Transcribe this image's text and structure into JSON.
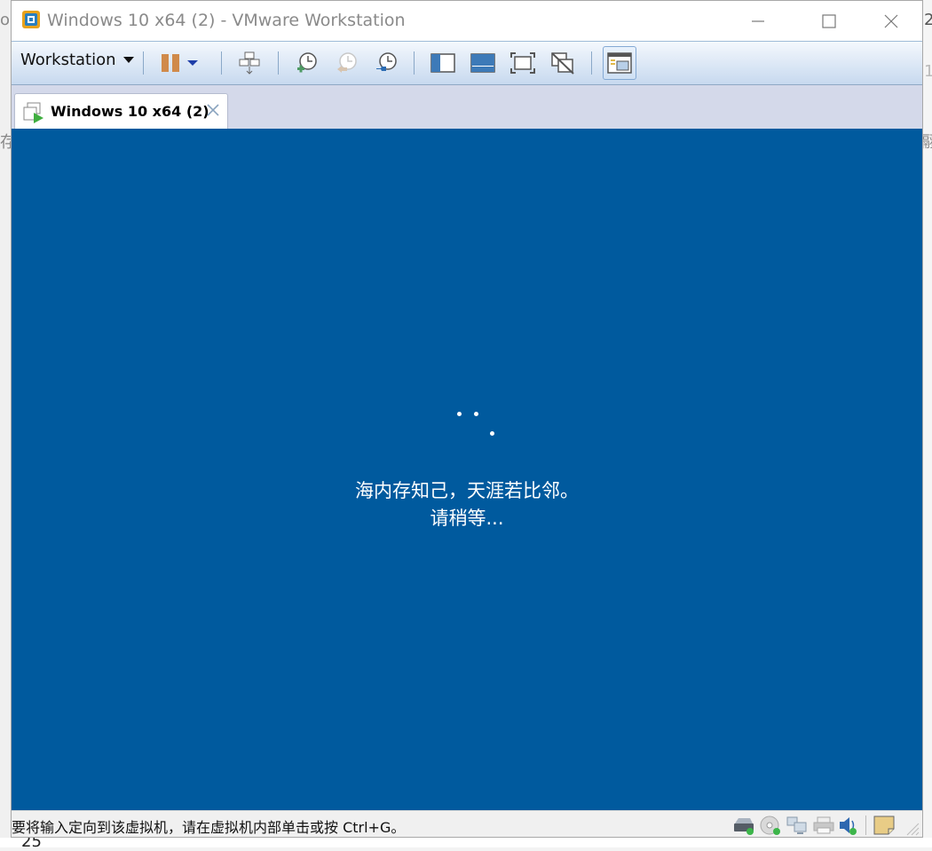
{
  "window": {
    "title": "Windows 10 x64 (2) - VMware Workstation",
    "minimize_label": "minimize",
    "maximize_label": "maximize",
    "close_label": "close"
  },
  "toolbar": {
    "menu_label": "Workstation",
    "buttons": [
      {
        "name": "pause",
        "icon": "pause-icon"
      },
      {
        "name": "power-dropdown",
        "icon": "chevron-down-icon"
      },
      {
        "name": "send-ctrl-alt-del",
        "icon": "network-send-icon"
      },
      {
        "name": "take-snapshot",
        "icon": "snapshot-add-icon"
      },
      {
        "name": "revert-snapshot",
        "icon": "snapshot-revert-icon"
      },
      {
        "name": "snapshot-manager",
        "icon": "snapshot-manager-icon"
      },
      {
        "name": "show-library",
        "icon": "library-icon"
      },
      {
        "name": "show-thumbnail-bar",
        "icon": "thumbnail-bar-icon"
      },
      {
        "name": "full-screen",
        "icon": "fullscreen-icon"
      },
      {
        "name": "unity",
        "icon": "unity-icon"
      },
      {
        "name": "console-view",
        "icon": "console-view-icon"
      }
    ]
  },
  "tabs": [
    {
      "label": "Windows 10 x64 (2)",
      "active": true
    }
  ],
  "vm_screen": {
    "background": "#005a9e",
    "message_line1": "海内存知己，天涯若比邻。",
    "message_line2": "请稍等..."
  },
  "statusbar": {
    "hint": "要将输入定向到该虚拟机，请在虚拟机内部单击或按 Ctrl+G。",
    "devices": [
      "hard-disk-icon",
      "cd-dvd-icon",
      "network-adapter-icon",
      "printer-icon",
      "sound-card-icon",
      "notes-icon"
    ]
  },
  "background_fragments": {
    "left_1": "og",
    "left_2": "存",
    "right_1": "2",
    "right_2": "1",
    "right_3": "翮",
    "bottom": "25"
  }
}
